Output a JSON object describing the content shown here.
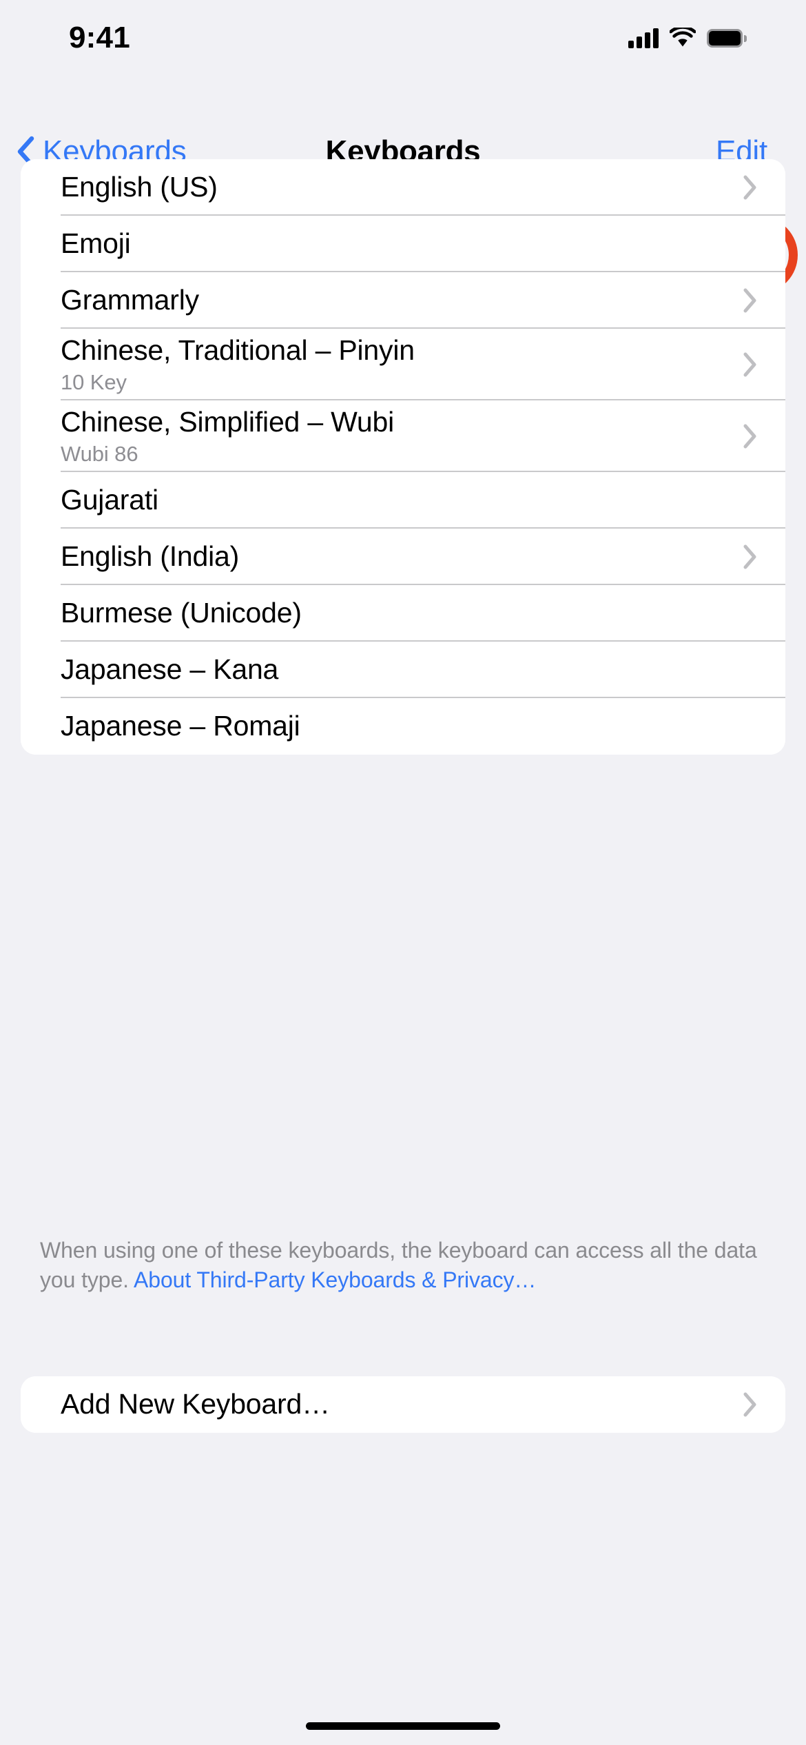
{
  "status_bar": {
    "time": "9:41",
    "cellular_icon": "cellular-signal-icon",
    "wifi_icon": "wifi-icon",
    "battery_icon": "battery-full-icon"
  },
  "nav": {
    "back_label": "Keyboards",
    "back_icon": "chevron-left-icon",
    "title": "Keyboards",
    "edit_label": "Edit",
    "highlight_color": "#E8421E"
  },
  "colors": {
    "accent_blue": "#3478F6",
    "background": "#F1F1F5",
    "card": "#FFFFFF",
    "separator": "#C9C9CB",
    "secondary_text": "#8E8E93",
    "annotation_red": "#E8421E"
  },
  "keyboards": [
    {
      "title": "English (US)",
      "subtitle": "",
      "chevron": true
    },
    {
      "title": "Emoji",
      "subtitle": "",
      "chevron": false
    },
    {
      "title": "Grammarly",
      "subtitle": "",
      "chevron": true
    },
    {
      "title": "Chinese, Traditional – Pinyin",
      "subtitle": "10 Key",
      "chevron": true
    },
    {
      "title": "Chinese, Simplified – Wubi",
      "subtitle": "Wubi 86",
      "chevron": true
    },
    {
      "title": "Gujarati",
      "subtitle": "",
      "chevron": false
    },
    {
      "title": "English (India)",
      "subtitle": "",
      "chevron": true
    },
    {
      "title": "Burmese (Unicode)",
      "subtitle": "",
      "chevron": false
    },
    {
      "title": "Japanese – Kana",
      "subtitle": "",
      "chevron": false
    },
    {
      "title": "Japanese – Romaji",
      "subtitle": "",
      "chevron": false
    }
  ],
  "footer": {
    "text": "When using one of these keyboards, the keyboard can access all the data you type. ",
    "link_text": "About Third-Party Keyboards & Privacy…"
  },
  "add_section": [
    {
      "title": "Add New Keyboard…",
      "subtitle": "",
      "chevron": true
    }
  ]
}
